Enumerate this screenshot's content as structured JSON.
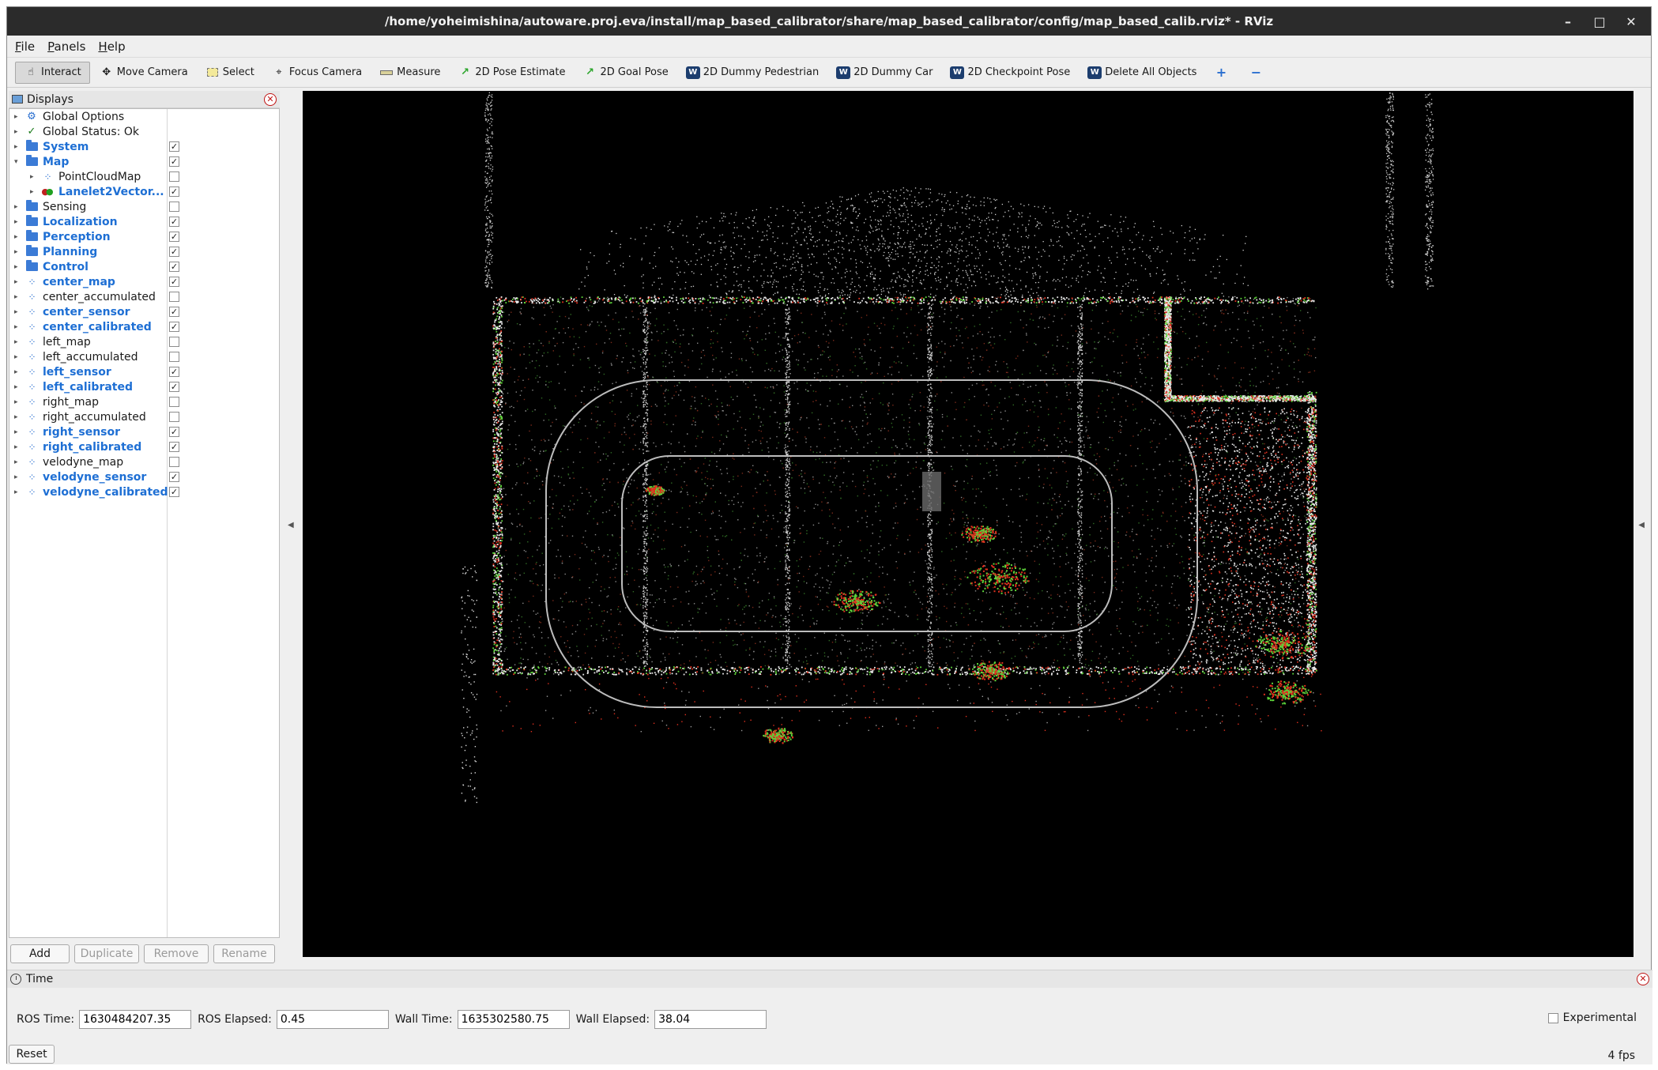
{
  "window": {
    "title": "/home/yoheimishina/autoware.proj.eva/install/map_based_calibrator/share/map_based_calibrator/config/map_based_calib.rviz* - RViz"
  },
  "menu": [
    "File",
    "Panels",
    "Help"
  ],
  "toolbar": [
    {
      "label": "Interact",
      "icon": "cursor-icon",
      "active": true
    },
    {
      "label": "Move Camera",
      "icon": "move-icon"
    },
    {
      "label": "Select",
      "icon": "select-icon"
    },
    {
      "label": "Focus Camera",
      "icon": "focus-icon"
    },
    {
      "label": "Measure",
      "icon": "ruler-icon"
    },
    {
      "label": "2D Pose Estimate",
      "icon": "green-arrow-icon"
    },
    {
      "label": "2D Goal Pose",
      "icon": "green-arrow-icon"
    },
    {
      "label": "2D Dummy Pedestrian",
      "icon": "autoware-icon"
    },
    {
      "label": "2D Dummy Car",
      "icon": "autoware-icon"
    },
    {
      "label": "2D Checkpoint Pose",
      "icon": "autoware-icon"
    },
    {
      "label": "Delete All Objects",
      "icon": "autoware-icon"
    }
  ],
  "displays": {
    "title": "Displays",
    "items": [
      {
        "label": "Global Options",
        "indent": 0,
        "icon": "globe-icon",
        "checkbox": false,
        "enabled": false
      },
      {
        "label": "Global Status: Ok",
        "indent": 0,
        "icon": "check-icon",
        "checkbox": false,
        "enabled": false
      },
      {
        "label": "System",
        "indent": 0,
        "icon": "folder-icon",
        "checkbox": true,
        "checked": true,
        "enabled": true
      },
      {
        "label": "Map",
        "indent": 0,
        "icon": "folder-icon",
        "checkbox": true,
        "checked": true,
        "enabled": true,
        "expanded": true
      },
      {
        "label": "PointCloudMap",
        "indent": 1,
        "icon": "dots-icon",
        "checkbox": true,
        "checked": false,
        "enabled": false
      },
      {
        "label": "Lanelet2Vector...",
        "indent": 1,
        "icon": "marker-icon",
        "checkbox": true,
        "checked": true,
        "enabled": true
      },
      {
        "label": "Sensing",
        "indent": 0,
        "icon": "folder-icon",
        "checkbox": true,
        "checked": false,
        "enabled": false
      },
      {
        "label": "Localization",
        "indent": 0,
        "icon": "folder-icon",
        "checkbox": true,
        "checked": true,
        "enabled": true
      },
      {
        "label": "Perception",
        "indent": 0,
        "icon": "folder-icon",
        "checkbox": true,
        "checked": true,
        "enabled": true
      },
      {
        "label": "Planning",
        "indent": 0,
        "icon": "folder-icon",
        "checkbox": true,
        "checked": true,
        "enabled": true
      },
      {
        "label": "Control",
        "indent": 0,
        "icon": "folder-icon",
        "checkbox": true,
        "checked": true,
        "enabled": true
      },
      {
        "label": "center_map",
        "indent": 0,
        "icon": "dots-icon",
        "checkbox": true,
        "checked": true,
        "enabled": true
      },
      {
        "label": "center_accumulated",
        "indent": 0,
        "icon": "dots-icon",
        "checkbox": true,
        "checked": false,
        "enabled": false
      },
      {
        "label": "center_sensor",
        "indent": 0,
        "icon": "dots-icon",
        "checkbox": true,
        "checked": true,
        "enabled": true
      },
      {
        "label": "center_calibrated",
        "indent": 0,
        "icon": "dots-icon",
        "checkbox": true,
        "checked": true,
        "enabled": true
      },
      {
        "label": "left_map",
        "indent": 0,
        "icon": "dots-icon",
        "checkbox": true,
        "checked": false,
        "enabled": false
      },
      {
        "label": "left_accumulated",
        "indent": 0,
        "icon": "dots-icon",
        "checkbox": true,
        "checked": false,
        "enabled": false
      },
      {
        "label": "left_sensor",
        "indent": 0,
        "icon": "dots-icon",
        "checkbox": true,
        "checked": true,
        "enabled": true
      },
      {
        "label": "left_calibrated",
        "indent": 0,
        "icon": "dots-icon",
        "checkbox": true,
        "checked": true,
        "enabled": true
      },
      {
        "label": "right_map",
        "indent": 0,
        "icon": "dots-icon",
        "checkbox": true,
        "checked": false,
        "enabled": false
      },
      {
        "label": "right_accumulated",
        "indent": 0,
        "icon": "dots-icon",
        "checkbox": true,
        "checked": false,
        "enabled": false
      },
      {
        "label": "right_sensor",
        "indent": 0,
        "icon": "dots-icon",
        "checkbox": true,
        "checked": true,
        "enabled": true
      },
      {
        "label": "right_calibrated",
        "indent": 0,
        "icon": "dots-icon",
        "checkbox": true,
        "checked": true,
        "enabled": true
      },
      {
        "label": "velodyne_map",
        "indent": 0,
        "icon": "dots-icon",
        "checkbox": true,
        "checked": false,
        "enabled": false
      },
      {
        "label": "velodyne_sensor",
        "indent": 0,
        "icon": "dots-icon",
        "checkbox": true,
        "checked": true,
        "enabled": true
      },
      {
        "label": "velodyne_calibrated",
        "indent": 0,
        "icon": "dots-icon",
        "checkbox": true,
        "checked": true,
        "enabled": true
      }
    ],
    "buttons": {
      "add": "Add",
      "duplicate": "Duplicate",
      "remove": "Remove",
      "rename": "Rename"
    }
  },
  "time": {
    "title": "Time",
    "ros_time_label": "ROS Time:",
    "ros_time": "1630484207.35",
    "ros_elapsed_label": "ROS Elapsed:",
    "ros_elapsed": "0.45",
    "wall_time_label": "Wall Time:",
    "wall_time": "1635302580.75",
    "wall_elapsed_label": "Wall Elapsed:",
    "wall_elapsed": "38.04",
    "experimental_label": "Experimental",
    "reset_label": "Reset",
    "fps": "4 fps"
  },
  "colors": {
    "enabled_label": "#1e6fd4",
    "viewport_bg": "#000000",
    "point_white": "#e8e8e8",
    "point_red": "#e0301e",
    "point_green": "#5ed43a"
  }
}
